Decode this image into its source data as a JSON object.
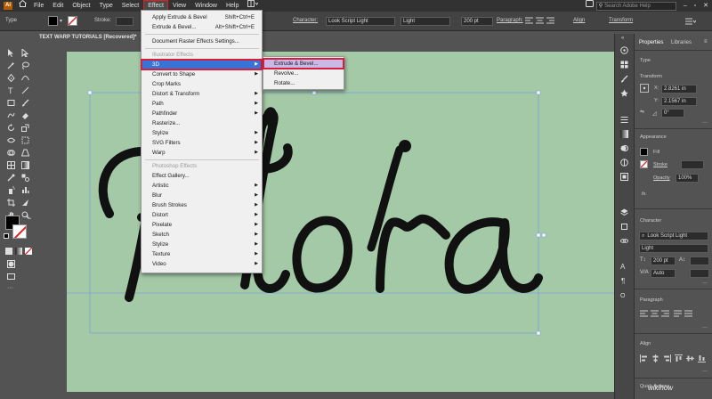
{
  "menubar": {
    "app_logo": "Ai",
    "items": [
      "File",
      "Edit",
      "Object",
      "Type",
      "Select",
      "Effect",
      "View",
      "Window",
      "Help"
    ],
    "active_item": "Effect",
    "search_placeholder": "Search Adobe Help"
  },
  "optbar": {
    "selection_label": "Type",
    "stroke_label": "Stroke:",
    "character_label": "Character:",
    "font_family": "Look Script Light",
    "font_style": "Light",
    "font_size": "200 pt",
    "paragraph_label": "Paragraph:",
    "align_label": "Align",
    "transform_label": "Transform"
  },
  "document_tab": "TEXT WARP TUTORIALS [Recovered]*",
  "effect_menu": {
    "items": [
      {
        "label": "Apply Extrude & Bevel",
        "shortcut": "Shift+Ctrl+E"
      },
      {
        "label": "Extrude & Bevel...",
        "shortcut": "Alt+Shift+Ctrl+E"
      },
      {
        "label": "Document Raster Effects Settings..."
      },
      {
        "label": "Illustrator Effects"
      },
      {
        "label": "3D",
        "submenu": true
      },
      {
        "label": "Convert to Shape",
        "submenu": true
      },
      {
        "label": "Crop Marks"
      },
      {
        "label": "Distort & Transform",
        "submenu": true
      },
      {
        "label": "Path",
        "submenu": true
      },
      {
        "label": "Pathfinder",
        "submenu": true
      },
      {
        "label": "Rasterize..."
      },
      {
        "label": "Stylize",
        "submenu": true
      },
      {
        "label": "SVG Filters",
        "submenu": true
      },
      {
        "label": "Warp",
        "submenu": true
      },
      {
        "label": "Photoshop Effects"
      },
      {
        "label": "Effect Gallery..."
      },
      {
        "label": "Artistic",
        "submenu": true
      },
      {
        "label": "Blur",
        "submenu": true
      },
      {
        "label": "Brush Strokes",
        "submenu": true
      },
      {
        "label": "Distort",
        "submenu": true
      },
      {
        "label": "Pixelate",
        "submenu": true
      },
      {
        "label": "Sketch",
        "submenu": true
      },
      {
        "label": "Stylize",
        "submenu": true
      },
      {
        "label": "Texture",
        "submenu": true
      },
      {
        "label": "Video",
        "submenu": true
      }
    ],
    "highlighted": "3D"
  },
  "submenu_3d": {
    "items": [
      "Extrude & Bevel...",
      "Revolve...",
      "Rotate..."
    ],
    "highlighted": "Extrude & Bevel..."
  },
  "artboard": {
    "text": "Flora",
    "background_color": "#a4c9a6",
    "text_color": "#111111"
  },
  "right_panel": {
    "tabs": [
      "Properties",
      "Libraries"
    ],
    "active_tab": "Properties",
    "type_header": "Type",
    "transform_header": "Transform",
    "x_label": "X:",
    "x_value": "2.8261 in",
    "y_label": "Y:",
    "y_value": "2.1567 in",
    "rotation_value": "0°",
    "appearance_header": "Appearance",
    "fill_label": "Fill",
    "stroke_label": "Stroke",
    "opacity_label": "Opacity",
    "opacity_value": "100%",
    "fx_label": "fx.",
    "character_header": "Character",
    "font_family": "Look Script Light",
    "font_style": "Light",
    "font_size": "200 pt",
    "leading": "Auto",
    "paragraph_header": "Paragraph",
    "align_header": "Align",
    "quick_actions_header": "Quick Actions"
  },
  "watermark": "wikihow"
}
